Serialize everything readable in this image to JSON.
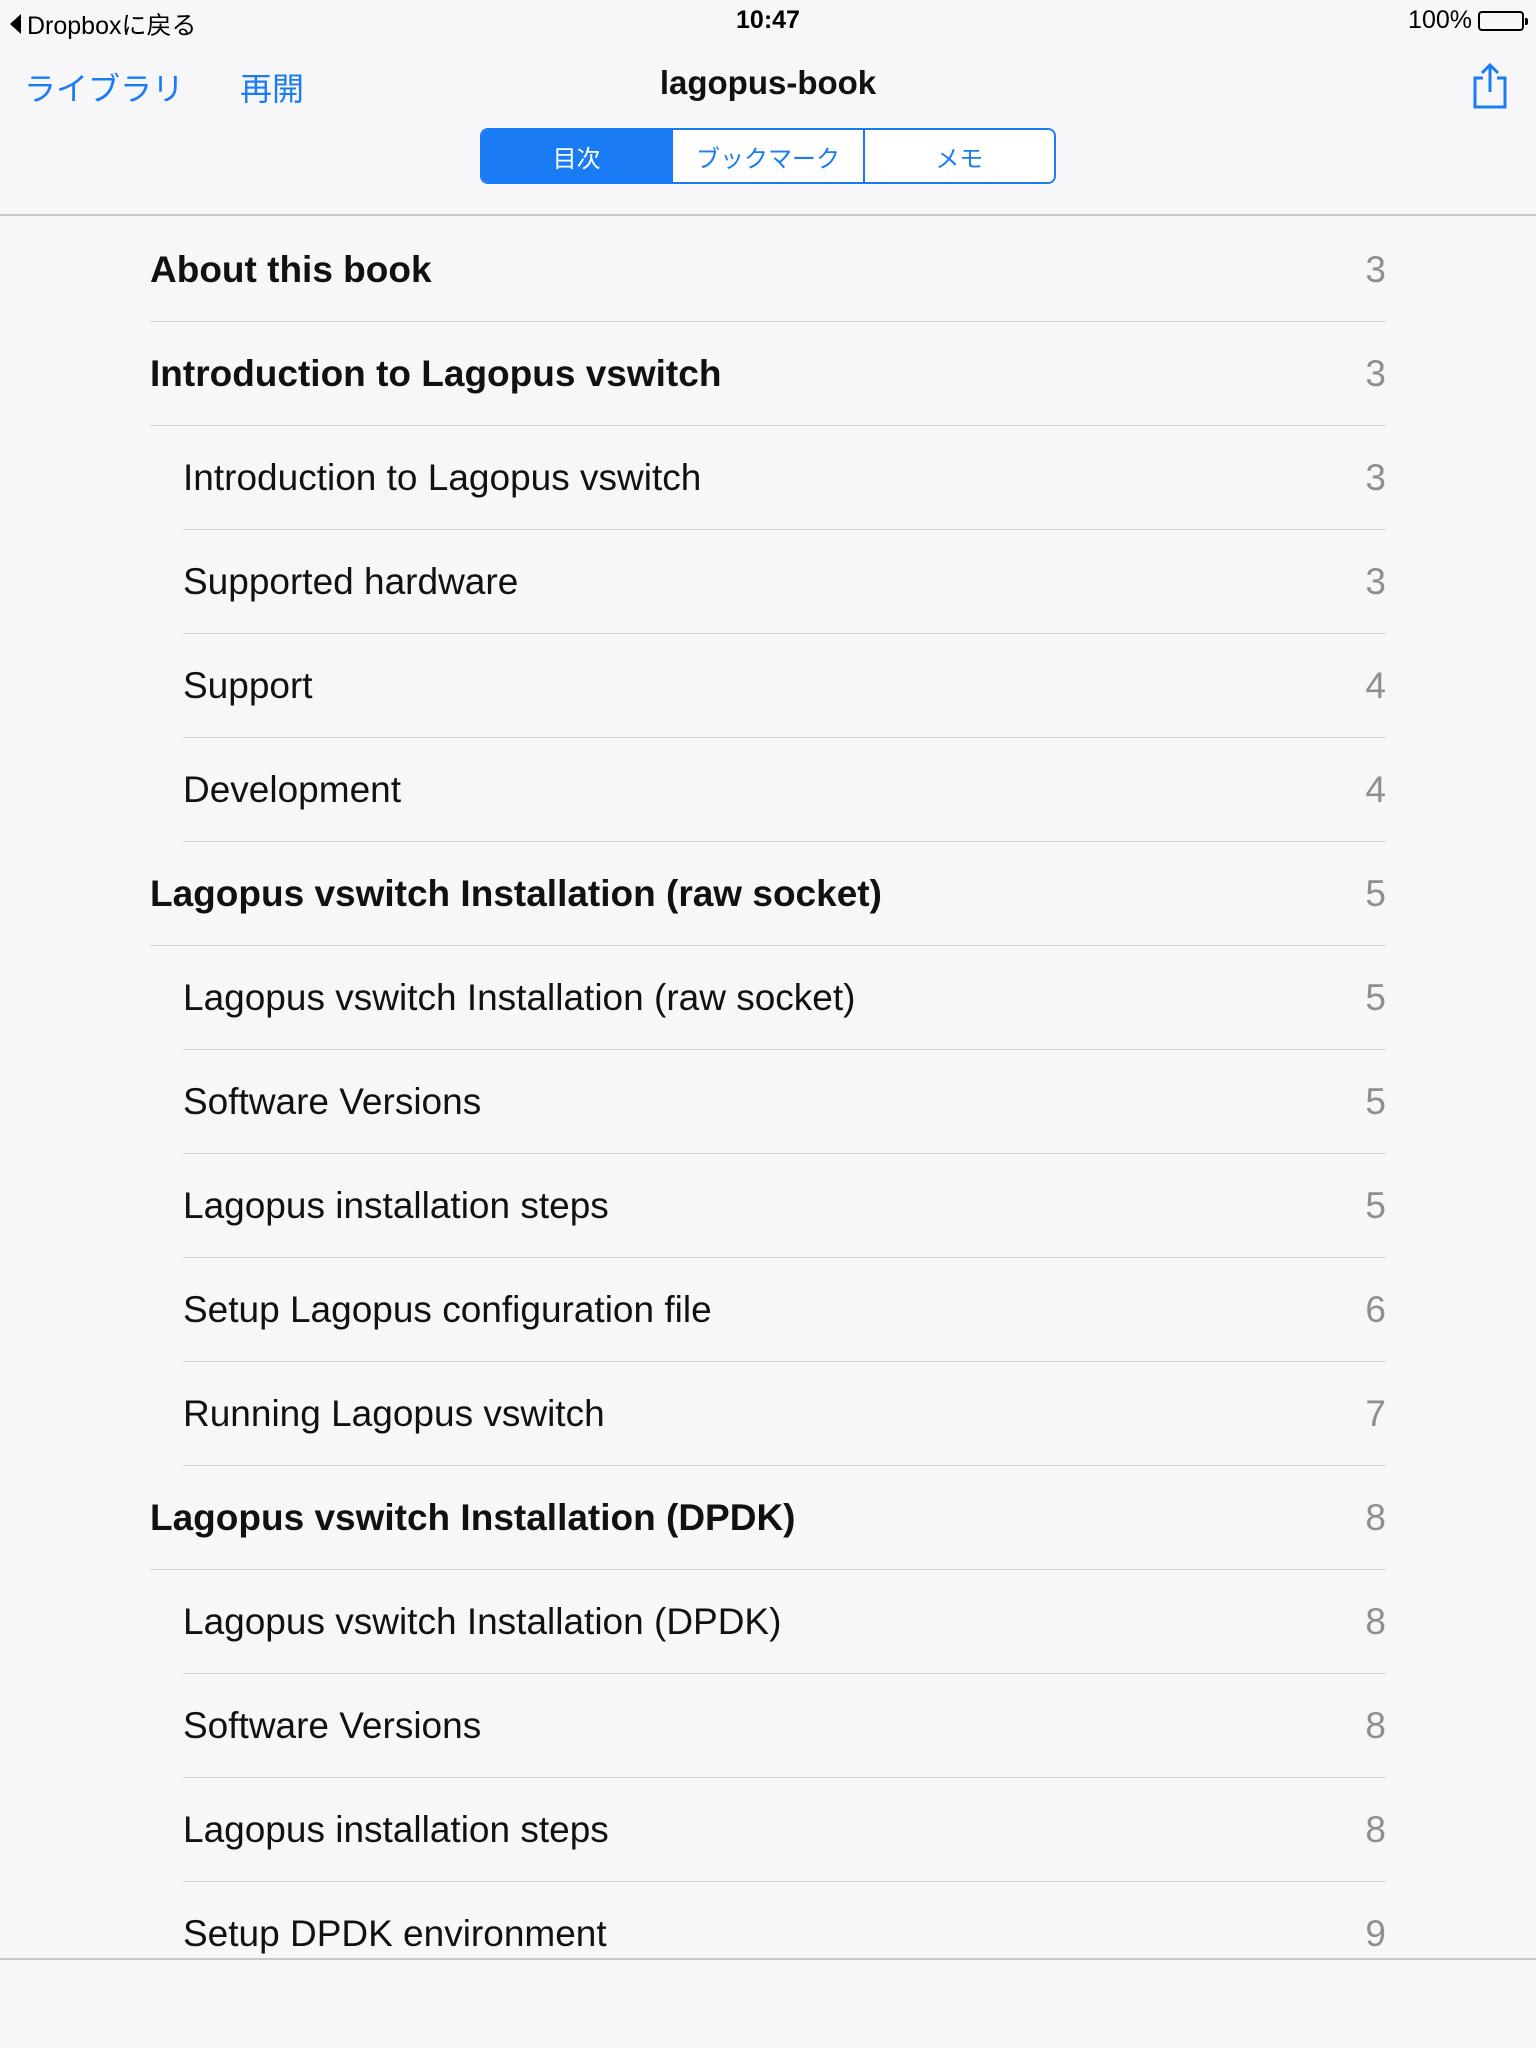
{
  "status": {
    "back_label": "Dropboxに戻る",
    "time": "10:47",
    "battery": "100%"
  },
  "nav": {
    "library": "ライブラリ",
    "resume": "再開",
    "title": "lagopus-book"
  },
  "tabs": [
    {
      "label": "目次",
      "selected": true
    },
    {
      "label": "ブックマーク",
      "selected": false
    },
    {
      "label": "メモ",
      "selected": false
    }
  ],
  "toc": [
    {
      "title": "About this book",
      "page": "3",
      "level": 1
    },
    {
      "title": "Introduction to Lagopus vswitch",
      "page": "3",
      "level": 1
    },
    {
      "title": "Introduction to Lagopus vswitch",
      "page": "3",
      "level": 2
    },
    {
      "title": "Supported hardware",
      "page": "3",
      "level": 2
    },
    {
      "title": "Support",
      "page": "4",
      "level": 2
    },
    {
      "title": "Development",
      "page": "4",
      "level": 2
    },
    {
      "title": "Lagopus vswitch Installation (raw socket)",
      "page": "5",
      "level": 1
    },
    {
      "title": "Lagopus vswitch Installation (raw socket)",
      "page": "5",
      "level": 2
    },
    {
      "title": "Software Versions",
      "page": "5",
      "level": 2
    },
    {
      "title": "Lagopus installation steps",
      "page": "5",
      "level": 2
    },
    {
      "title": "Setup Lagopus configuration file",
      "page": "6",
      "level": 2
    },
    {
      "title": "Running Lagopus vswitch",
      "page": "7",
      "level": 2
    },
    {
      "title": "Lagopus vswitch Installation (DPDK)",
      "page": "8",
      "level": 1
    },
    {
      "title": "Lagopus vswitch Installation (DPDK)",
      "page": "8",
      "level": 2
    },
    {
      "title": "Software Versions",
      "page": "8",
      "level": 2
    },
    {
      "title": "Lagopus installation steps",
      "page": "8",
      "level": 2
    },
    {
      "title": "Setup DPDK environment",
      "page": "9",
      "level": 2
    }
  ],
  "colors": {
    "accent": "#1a7cf5",
    "page_number": "#8e8e93"
  }
}
